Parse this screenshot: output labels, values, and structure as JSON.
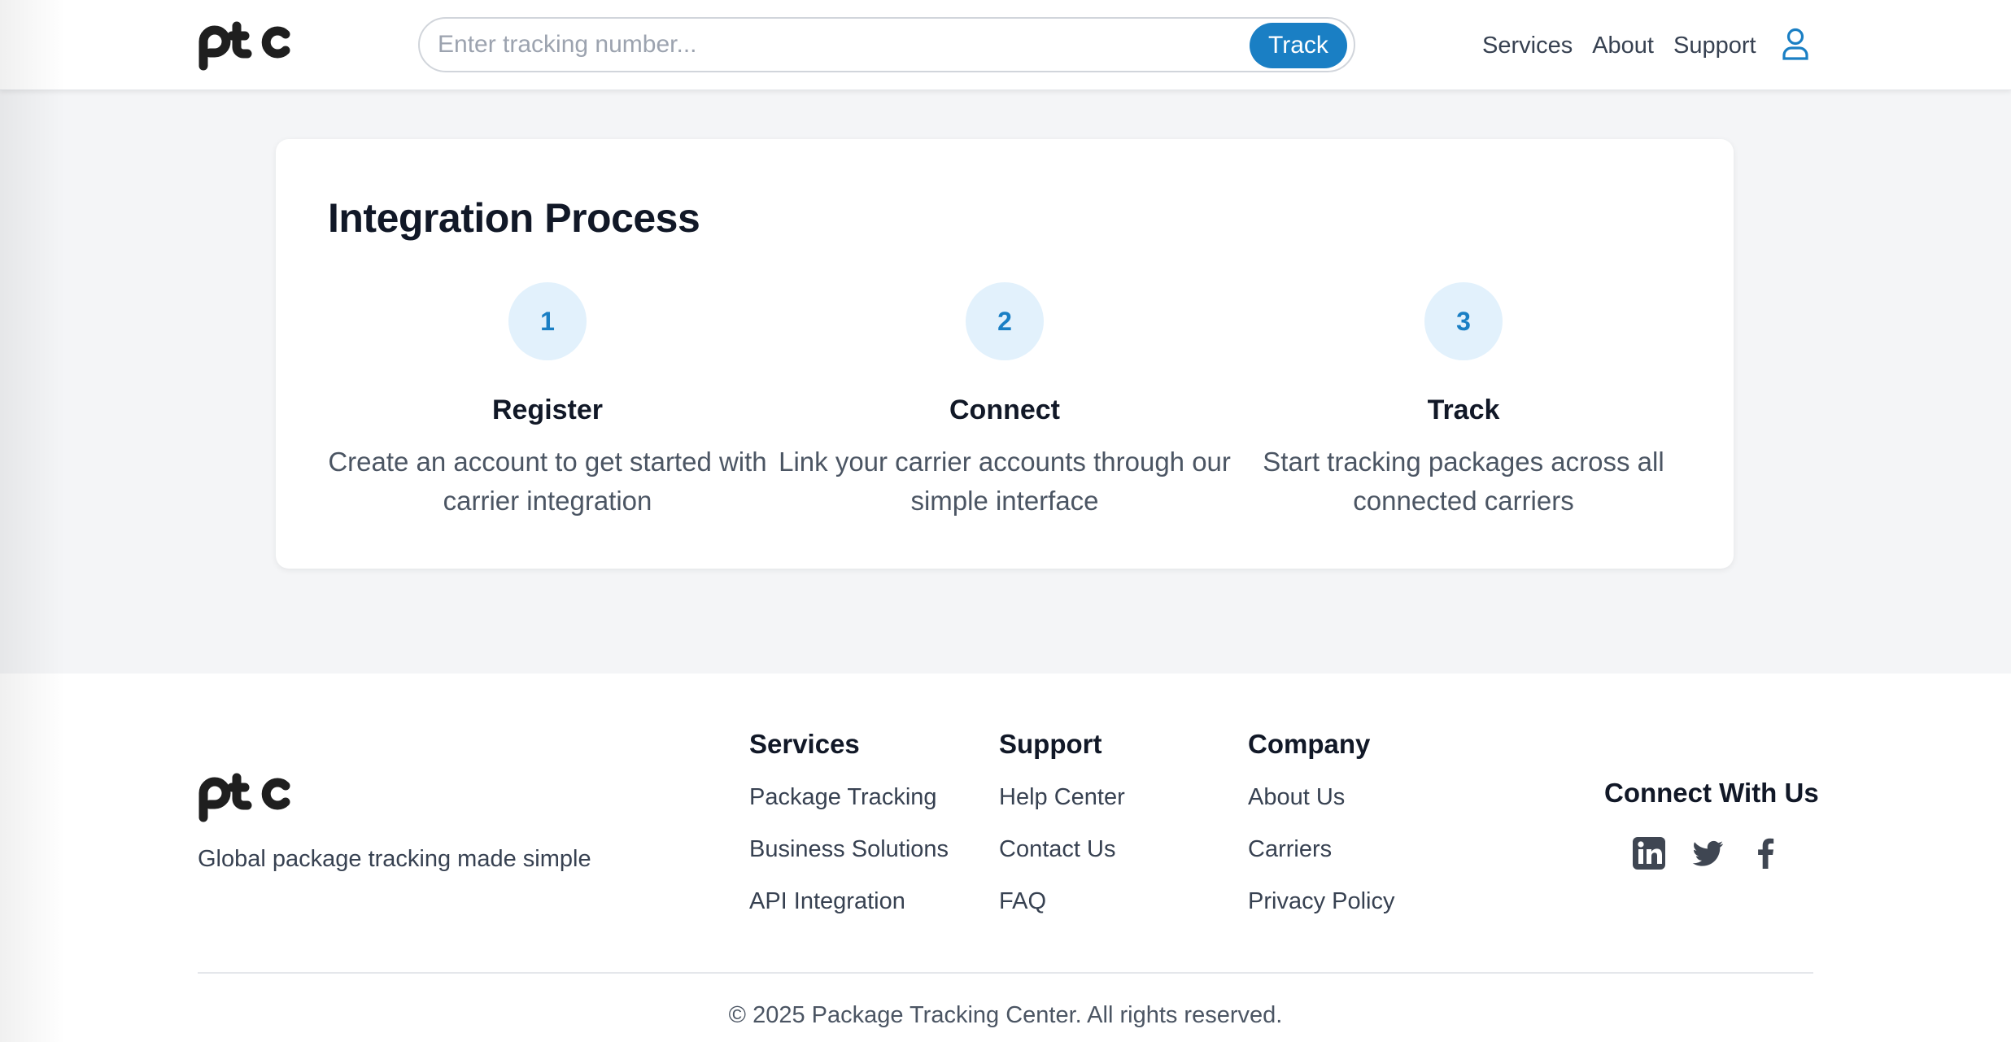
{
  "brand": {
    "logo_text": "ptc",
    "tagline": "Global package tracking made simple"
  },
  "header": {
    "search": {
      "placeholder": "Enter tracking number...",
      "value": ""
    },
    "track_label": "Track",
    "nav": [
      "Services",
      "About",
      "Support"
    ],
    "account_icon": "user-icon"
  },
  "integration": {
    "title": "Integration Process",
    "steps": [
      {
        "number": "1",
        "title": "Register",
        "description": "Create an account to get started with carrier integration"
      },
      {
        "number": "2",
        "title": "Connect",
        "description": "Link your carrier accounts through our simple interface"
      },
      {
        "number": "3",
        "title": "Track",
        "description": "Start tracking packages across all connected carriers"
      }
    ]
  },
  "footer": {
    "columns": [
      {
        "heading": "Services",
        "links": [
          "Package Tracking",
          "Business Solutions",
          "API Integration"
        ]
      },
      {
        "heading": "Support",
        "links": [
          "Help Center",
          "Contact Us",
          "FAQ"
        ]
      },
      {
        "heading": "Company",
        "links": [
          "About Us",
          "Carriers",
          "Privacy Policy"
        ]
      }
    ],
    "social_title": "Connect With Us",
    "social_icons": [
      "linkedin-icon",
      "twitter-icon",
      "facebook-icon"
    ],
    "copyright": "© 2025 Package Tracking Center. All rights reserved."
  },
  "colors": {
    "accent": "#1a7fc4",
    "accent_light": "#e2f1fc",
    "logo": "#1f1f1f",
    "background": "#f4f5f7"
  }
}
